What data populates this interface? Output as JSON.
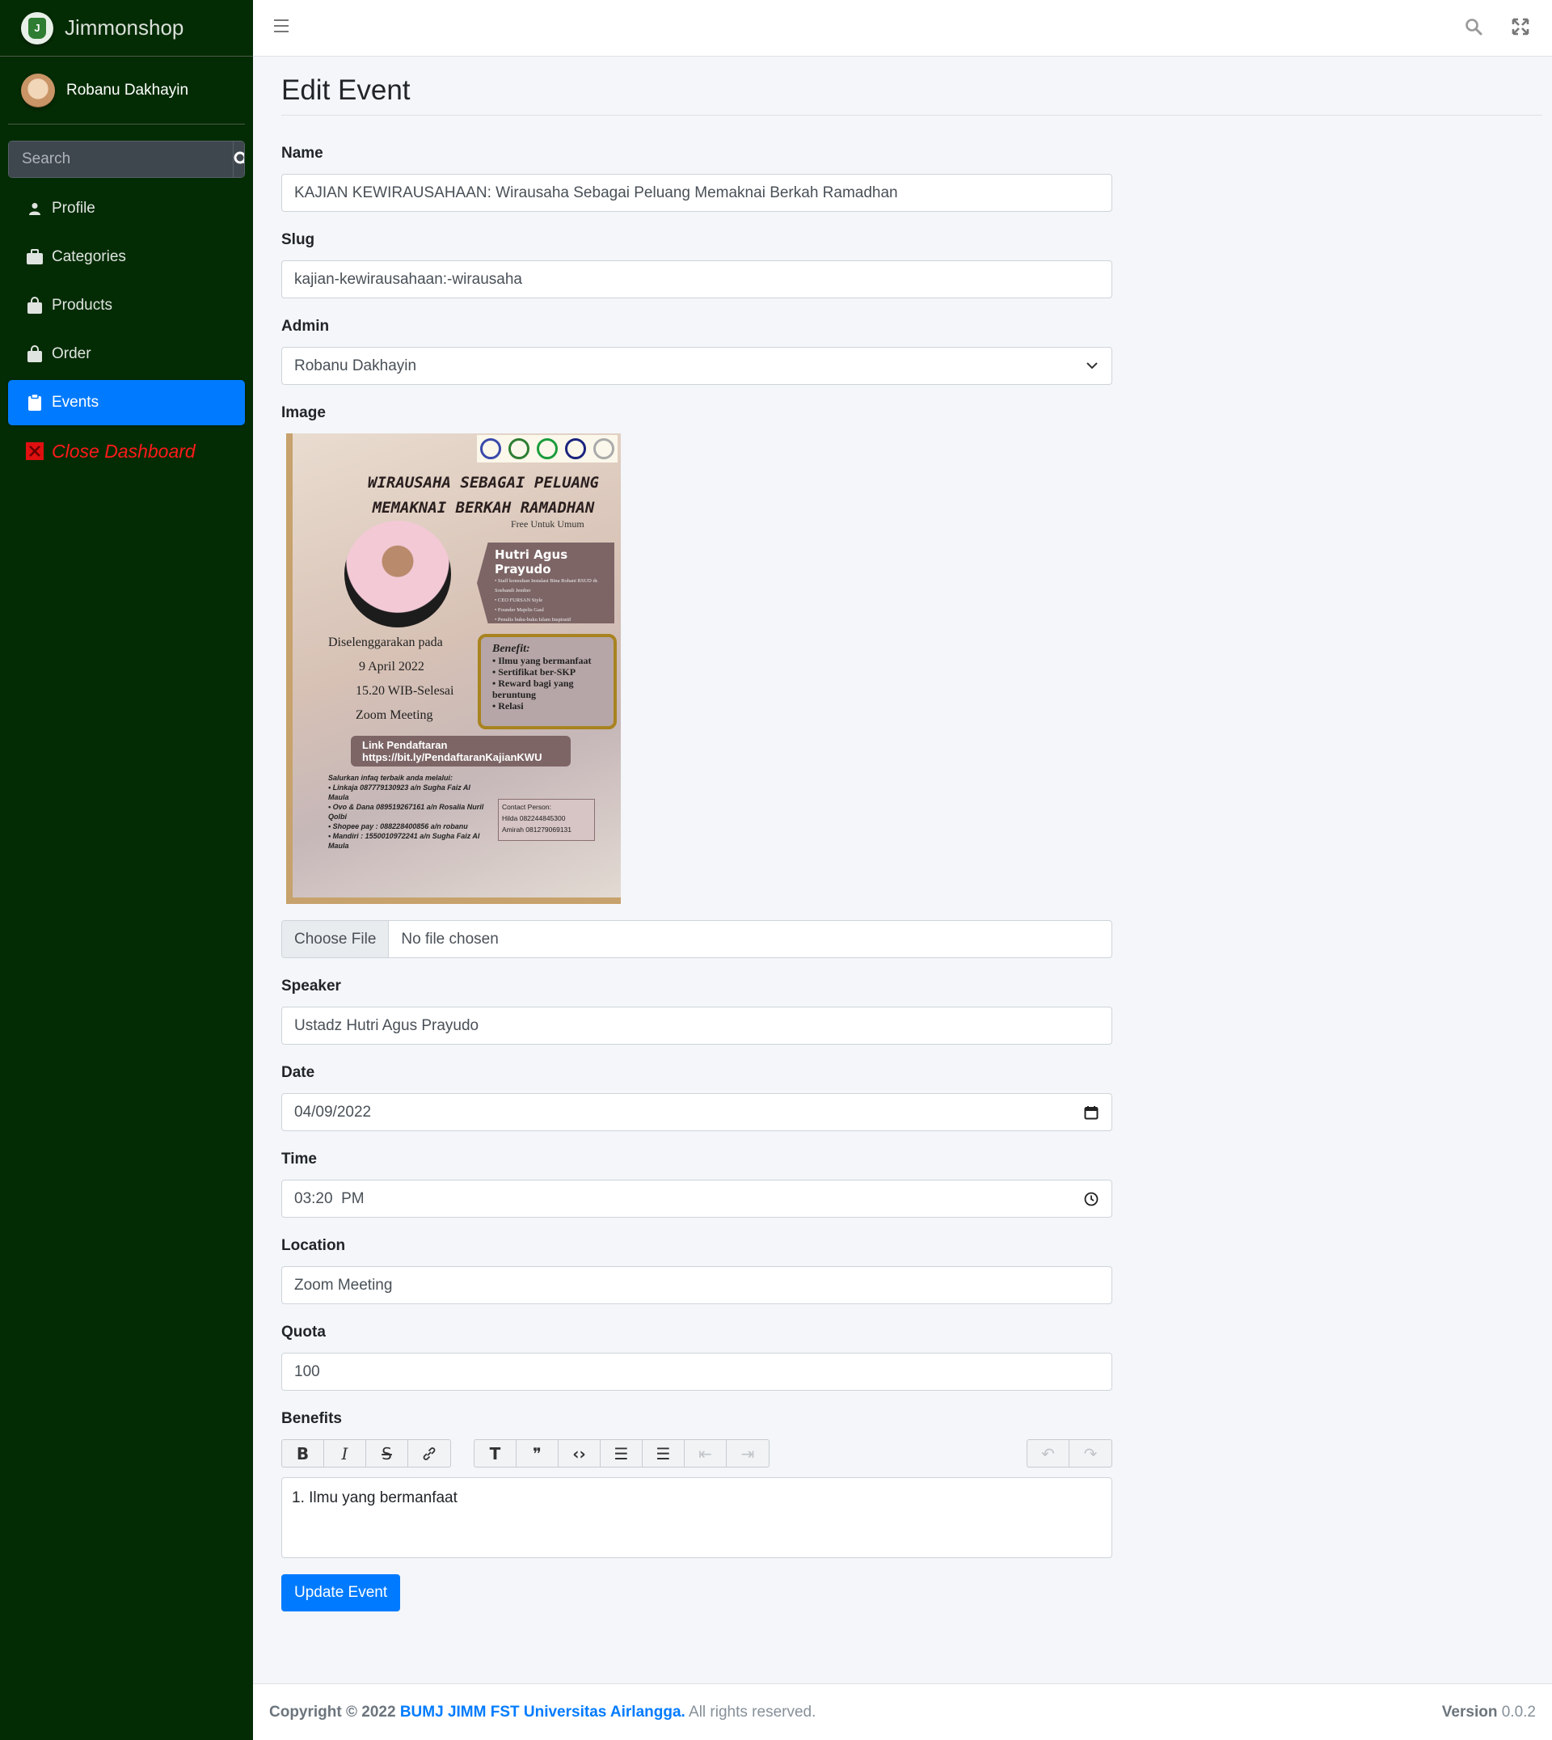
{
  "brand": {
    "name": "Jimmonshop",
    "logo_icon": "shop-logo-icon"
  },
  "user": {
    "name": "Robanu Dakhayin"
  },
  "sidebar_search": {
    "placeholder": "Search"
  },
  "sidebar": {
    "items": [
      {
        "label": "Profile",
        "icon": "user-icon",
        "active": false
      },
      {
        "label": "Categories",
        "icon": "briefcase-icon",
        "active": false
      },
      {
        "label": "Products",
        "icon": "shopping-bag-icon",
        "active": false
      },
      {
        "label": "Order",
        "icon": "shopping-bag-icon",
        "active": false
      },
      {
        "label": "Events",
        "icon": "clipboard-icon",
        "active": true
      },
      {
        "label": "Close Dashboard",
        "icon": "close-square-icon",
        "active": false
      }
    ]
  },
  "page": {
    "title": "Edit Event"
  },
  "form": {
    "name": {
      "label": "Name",
      "value": "KAJIAN KEWIRAUSAHAAN: Wirausaha Sebagai Peluang Memaknai Berkah Ramadhan"
    },
    "slug": {
      "label": "Slug",
      "value": "kajian-kewirausahaan:-wirausaha"
    },
    "admin": {
      "label": "Admin",
      "value": "Robanu Dakhayin"
    },
    "image": {
      "label": "Image",
      "poster": {
        "title_line1": "WIRAUSAHA SEBAGAI PELUANG",
        "title_line2": "MEMAKNAI BERKAH RAMADHAN",
        "subtitle": "Free Untuk Umum",
        "speaker_name": "Hutri Agus Prayudo",
        "speaker_desc": [
          "• Staff konsultan Instalasi Bina Rohani RSUD dr. Soebandi Jember",
          "• CEO FURSAN Style",
          "• Founder Majelis Gaul",
          "• Penulis buku-buku Islam Inspiratif"
        ],
        "held_on": "Diselenggarakan pada",
        "date": "9 April 2022",
        "time": "15.20 WIB-Selesai",
        "place": "Zoom Meeting",
        "benefit_title": "Benefit:",
        "benefits": [
          "• Ilmu yang bermanfaat",
          "• Sertifikat ber-SKP",
          "• Reward bagi yang beruntung",
          "• Relasi"
        ],
        "link_label": "Link Pendaftaran",
        "link_url": "https://bit.ly/PendaftaranKajianKWU",
        "infaq_title": "Salurkan infaq terbaik anda melalui:",
        "infaq": [
          "• Linkaja 087779130923 a/n Sugha Faiz Al Maula",
          "• Ovo & Dana 089519267161 a/n Rosalia Nuril Qolbi",
          "• Shopee pay : 088228400856 a/n robanu",
          "• Mandiri : 1550010972241 a/n Sugha Faiz Al Maula"
        ],
        "contact_title": "Contact Person:",
        "contact_1": "Hilda 082244845300",
        "contact_2": "Amirah 081279069131"
      }
    },
    "file": {
      "button": "Choose File",
      "status": "No file chosen"
    },
    "speaker": {
      "label": "Speaker",
      "value": "Ustadz Hutri Agus Prayudo"
    },
    "date": {
      "label": "Date",
      "value": "04/09/2022"
    },
    "time": {
      "label": "Time",
      "value": "03:20  PM"
    },
    "location": {
      "label": "Location",
      "value": "Zoom Meeting"
    },
    "quota": {
      "label": "Quota",
      "value": "100"
    },
    "benefits": {
      "label": "Benefits",
      "content": "1. Ilmu yang bermanfaat",
      "toolbar": {
        "bold": "B",
        "italic": "I",
        "strike": "S",
        "link": "🔗",
        "heading": "T",
        "quote": "❞",
        "code": "‹›",
        "bullets": "☰",
        "numbers": "☰",
        "outdent": "⇤",
        "indent": "⇥",
        "undo": "↶",
        "redo": "↷"
      }
    },
    "submit": "Update Event"
  },
  "footer": {
    "copyright_prefix": "Copyright © 2022 ",
    "org": "BUMJ JIMM FST Universitas Airlangga.",
    "rights": " All rights reserved.",
    "version_label": "Version",
    "version": " 0.0.2"
  },
  "colors": {
    "sidebar_bg": "#042c04",
    "accent": "#007bff",
    "close_dashboard": "#ff1a1a"
  }
}
